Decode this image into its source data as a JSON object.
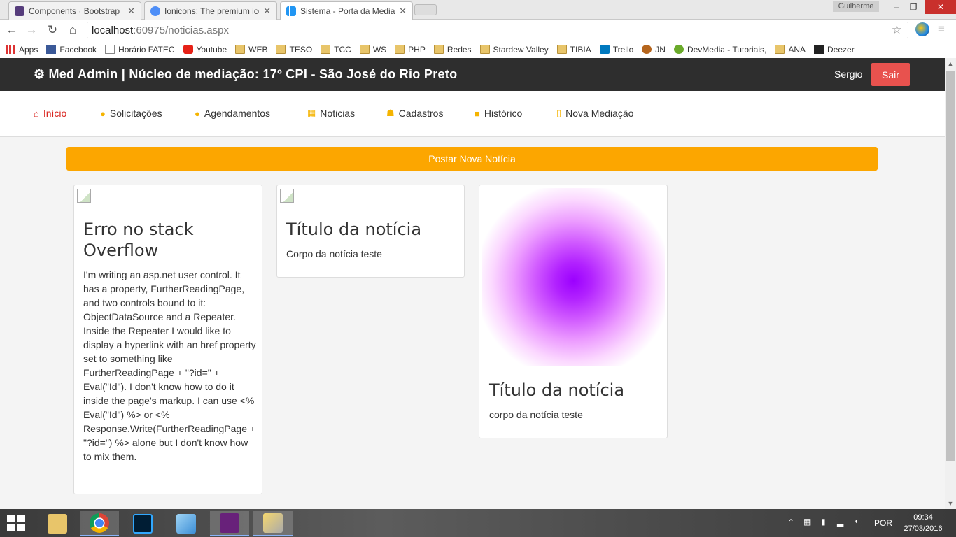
{
  "browser": {
    "tabs": [
      {
        "label": "Components · Bootstrap",
        "favicon_color": "#563d7c"
      },
      {
        "label": "Ionicons: The premium ico",
        "favicon_color": "#4e8ef7"
      },
      {
        "label": "Sistema - Porta da Mediaç",
        "favicon_color": "#2196f3"
      }
    ],
    "profile_name": "Guilherme",
    "url_host": "localhost",
    "url_path": ":60975/noticias.aspx",
    "bookmarks": [
      {
        "label": "Apps",
        "icon": "apps-grid-icon"
      },
      {
        "label": "Facebook",
        "icon": "facebook-icon"
      },
      {
        "label": "Horário FATEC",
        "icon": "page-icon"
      },
      {
        "label": "Youtube",
        "icon": "youtube-icon"
      },
      {
        "label": "WEB",
        "icon": "folder-icon"
      },
      {
        "label": "TESO",
        "icon": "folder-icon"
      },
      {
        "label": "TCC",
        "icon": "folder-icon"
      },
      {
        "label": "WS",
        "icon": "folder-icon"
      },
      {
        "label": "PHP",
        "icon": "folder-icon"
      },
      {
        "label": "Redes",
        "icon": "folder-icon"
      },
      {
        "label": "Stardew Valley",
        "icon": "folder-icon"
      },
      {
        "label": "TIBIA",
        "icon": "folder-icon"
      },
      {
        "label": "Trello",
        "icon": "trello-icon"
      },
      {
        "label": "JN",
        "icon": "jn-icon"
      },
      {
        "label": "DevMedia - Tutoriais,",
        "icon": "devmedia-icon"
      },
      {
        "label": "ANA",
        "icon": "folder-icon"
      },
      {
        "label": "Deezer",
        "icon": "deezer-icon"
      }
    ]
  },
  "header": {
    "brand": "Med Admin | Núcleo de mediação: 17º CPI - São José do Rio Preto",
    "user": "Sergio",
    "logout": "Sair"
  },
  "nav": [
    {
      "label": "Início",
      "icon": "home-icon",
      "active": true
    },
    {
      "label": "Solicitações",
      "icon": "circle-icon"
    },
    {
      "label": "Agendamentos",
      "icon": "chat-bubble-icon"
    },
    {
      "label": "Noticias",
      "icon": "calendar-icon"
    },
    {
      "label": "Cadastros",
      "icon": "users-icon"
    },
    {
      "label": "Histórico",
      "icon": "folder-icon"
    },
    {
      "label": "Nova Mediação",
      "icon": "document-icon"
    }
  ],
  "main": {
    "post_button": "Postar Nova Notícia",
    "cards": [
      {
        "title": "Erro no stack Overflow",
        "body": "I'm writing an asp.net user control. It has a property, FurtherReadingPage, and two controls bound to it: ObjectDataSource and a Repeater. Inside the Repeater I would like to display a hyperlink with an href property set to something like FurtherReadingPage + \"?id=\" + Eval(\"Id\"). I don't know how to do it inside the page's markup. I can use <% Eval(\"Id\") %> or <% Response.Write(FurtherReadingPage + \"?id=\") %> alone but I don't know how to mix them.",
        "image": "broken"
      },
      {
        "title": "Título da notícia",
        "body": "Corpo da notícia teste",
        "image": "broken"
      },
      {
        "title": "Título da notícia",
        "body": "corpo da notícia teste",
        "image": "purple-blob"
      }
    ]
  },
  "taskbar": {
    "language": "POR",
    "time": "09:34",
    "date": "27/03/2016"
  },
  "colors": {
    "header_bg": "#2e2e2e",
    "logout_bg": "#e8524e",
    "accent_orange": "#fca600",
    "active_nav": "#d9231d"
  }
}
